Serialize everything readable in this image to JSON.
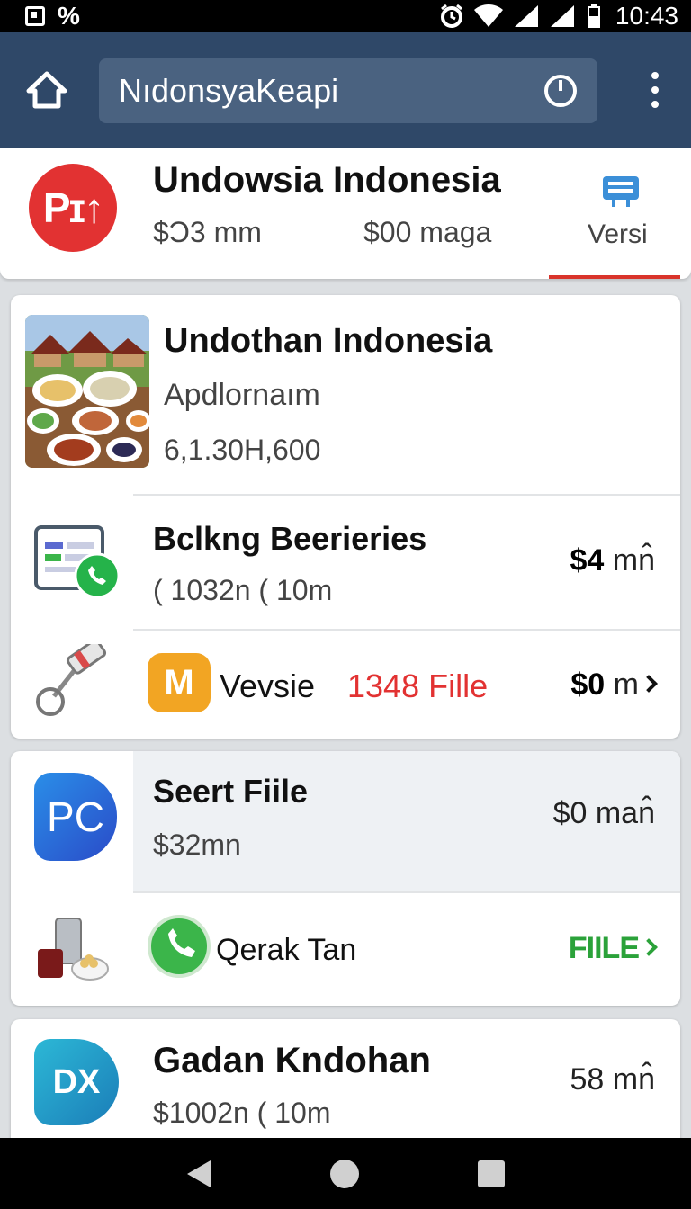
{
  "status_bar": {
    "time": "10:43",
    "percent_icon": "%"
  },
  "appbar": {
    "search_text": "NıdonsyaKeapi",
    "icons": [
      "home-icon",
      "power-icon",
      "more-vert-icon"
    ]
  },
  "header_card": {
    "title": "Undowsia Indonesia",
    "sub1": "$Ɔ3 mm",
    "sub2": "$00 maga",
    "logo_text": "Pɪ↑",
    "versi_label": "Versi",
    "accent_color": "#d9342b"
  },
  "card1": {
    "title": "Undothan Indonesia",
    "subtitle": "Apdlornaım",
    "number": "6,1.30H,600",
    "rows": [
      {
        "title": "Bclkng Beerieries",
        "sub": "( 1032n ( 10m",
        "price_bold": "$4",
        "price_unit": "mn̂"
      },
      {
        "title": "Vevsie",
        "file_count": "1348 Fille",
        "price_bold": "$0",
        "price_unit": "m"
      }
    ]
  },
  "card2": {
    "title": "Seert Fiile",
    "sub": "$32mn",
    "price": "$0 man̂",
    "row2_label": "Qerak Tan",
    "row2_action": "FIILE"
  },
  "card3": {
    "title": "Gadan Kndohan",
    "sub": "$1002n ( 10m",
    "price": "58 mn̂"
  },
  "colors": {
    "appbar": "#2f4868",
    "red": "#e23232",
    "green": "#2ba23a",
    "file_red": "#e23232"
  }
}
